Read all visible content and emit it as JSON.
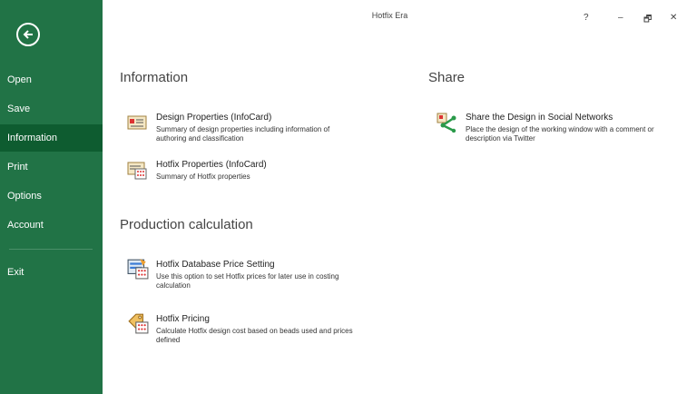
{
  "app": {
    "title": "Hotfix Era"
  },
  "window_controls": {
    "help": "?",
    "minimize": "–",
    "restore": "🗗",
    "close": "✕"
  },
  "sidebar": {
    "items": [
      {
        "label": "Open"
      },
      {
        "label": "Save"
      },
      {
        "label": "Information",
        "active": true
      },
      {
        "label": "Print"
      },
      {
        "label": "Options"
      },
      {
        "label": "Account"
      },
      {
        "label": "Exit"
      }
    ]
  },
  "information": {
    "title": "Information",
    "items": [
      {
        "title": "Design Properties (InfoCard)",
        "desc": "Summary of design properties including information of authoring and classification",
        "icon": "infocard-icon"
      },
      {
        "title": "Hotfix Properties (InfoCard)",
        "desc": "Summary of Hotfix properties",
        "icon": "hotfix-infocard-icon"
      }
    ]
  },
  "production": {
    "title": "Production calculation",
    "items": [
      {
        "title": "Hotfix Database Price Setting",
        "desc": "Use this option to set Hotfix prices for later use in costing calculation",
        "icon": "price-database-icon"
      },
      {
        "title": "Hotfix Pricing",
        "desc": "Calculate Hotfix design cost based on beads used and prices defined",
        "icon": "price-tag-icon"
      }
    ]
  },
  "share": {
    "title": "Share",
    "items": [
      {
        "title": "Share the Design in Social Networks",
        "desc": "Place the design of the working window with a comment or description via Twitter",
        "icon": "share-icon"
      }
    ]
  },
  "colors": {
    "sidebar": "#217346",
    "active": "#0e5c30"
  }
}
